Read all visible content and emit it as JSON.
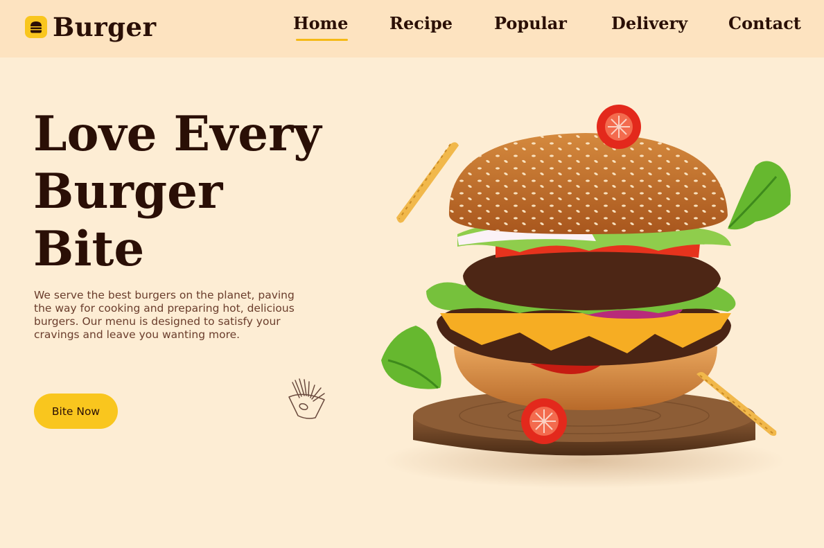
{
  "brand": {
    "name": "Burger",
    "logo_icon": "burger-icon"
  },
  "nav": {
    "items": [
      {
        "label": "Home",
        "active": true
      },
      {
        "label": "Recipe"
      },
      {
        "label": "Popular"
      },
      {
        "label": "Delivery"
      },
      {
        "label": "Contact"
      }
    ],
    "active_color": "#f5b916"
  },
  "hero": {
    "title_lines": [
      "Love Every",
      "Burger",
      "Bite"
    ],
    "description": "We serve the best burgers on the planet, paving the way for cooking and preparing hot, delicious burgers. Our menu is designed to satisfy your cravings and leave you wanting more.",
    "cta_label": "Bite Now",
    "doodle_icon": "fries-doodle-icon",
    "image": "burger-illustration"
  },
  "colors": {
    "background": "#fdedd4",
    "header_background": "#fde3c0",
    "accent": "#f9c61e",
    "text_dark": "#2a0f06",
    "text_body": "#6a3d2c"
  }
}
